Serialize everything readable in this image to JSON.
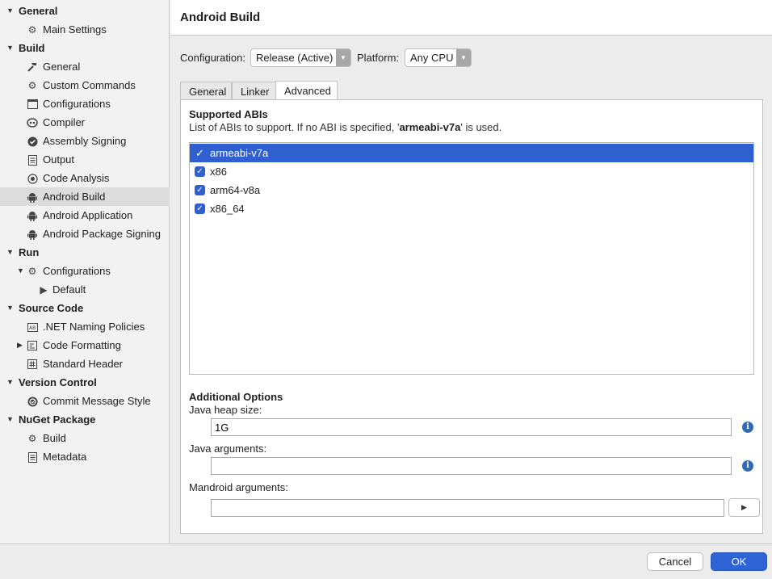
{
  "sidebar": {
    "categories": {
      "general": "General",
      "build": "Build",
      "run": "Run",
      "source_code": "Source Code",
      "version_control": "Version Control",
      "nuget_package": "NuGet Package"
    },
    "items": {
      "main_settings": "Main Settings",
      "build_general": "General",
      "custom_commands": "Custom Commands",
      "configurations": "Configurations",
      "compiler": "Compiler",
      "assembly_signing": "Assembly Signing",
      "output": "Output",
      "code_analysis": "Code Analysis",
      "android_build": "Android Build",
      "android_application": "Android Application",
      "android_package_signing": "Android Package Signing",
      "run_configurations": "Configurations",
      "run_default": "Default",
      "net_naming_policies": ".NET Naming Policies",
      "code_formatting": "Code Formatting",
      "standard_header": "Standard Header",
      "commit_message_style": "Commit Message Style",
      "nuget_build": "Build",
      "nuget_metadata": "Metadata"
    },
    "selected": "android_build"
  },
  "header": {
    "title": "Android Build"
  },
  "config_bar": {
    "configuration_label": "Configuration:",
    "configuration_value": "Release (Active)",
    "platform_label": "Platform:",
    "platform_value": "Any CPU"
  },
  "tabs": {
    "general": "General",
    "linker": "Linker",
    "advanced": "Advanced",
    "active": "advanced"
  },
  "abis": {
    "title": "Supported ABIs",
    "desc_prefix": "List of ABIs to support. If no ABI is specified, '",
    "desc_bold": "armeabi-v7a",
    "desc_suffix": "' is used.",
    "list": [
      {
        "label": "armeabi-v7a",
        "checked": true,
        "selected": true
      },
      {
        "label": "x86",
        "checked": true,
        "selected": false
      },
      {
        "label": "arm64-v8a",
        "checked": true,
        "selected": false
      },
      {
        "label": "x86_64",
        "checked": true,
        "selected": false
      }
    ]
  },
  "additional": {
    "title": "Additional Options",
    "heap_label": "Java heap size:",
    "heap_value": "1G",
    "java_args_label": "Java arguments:",
    "java_args_value": "",
    "mandroid_label": "Mandroid arguments:",
    "mandroid_value": ""
  },
  "footer": {
    "cancel": "Cancel",
    "ok": "OK"
  },
  "colors": {
    "accent": "#2e63d6",
    "selection": "#2f5fd0",
    "info": "#2f6ab7"
  }
}
